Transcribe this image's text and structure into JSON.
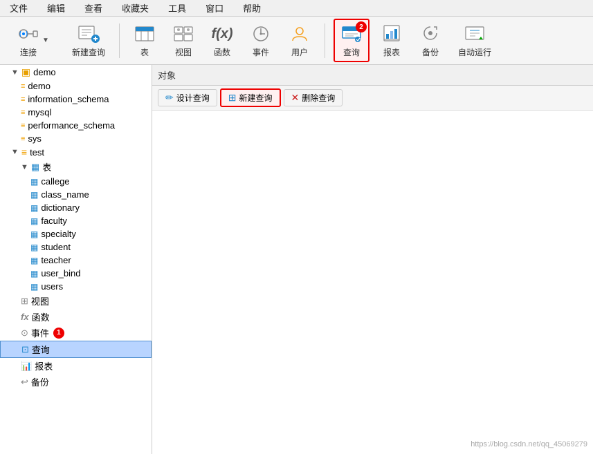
{
  "menubar": {
    "items": [
      "文件",
      "编辑",
      "查看",
      "收藏夹",
      "工具",
      "窗口",
      "帮助"
    ]
  },
  "toolbar": {
    "connect_label": "连接",
    "new_query_label": "新建查询",
    "table_label": "表",
    "view_label": "视图",
    "function_label": "函数",
    "event_label": "事件",
    "user_label": "用户",
    "query_label": "查询",
    "report_label": "报表",
    "backup_label": "备份",
    "autorun_label": "自动运行",
    "badge2": "2"
  },
  "sidebar": {
    "demo_group": "demo",
    "items": [
      {
        "label": "demo",
        "type": "db",
        "indent": 1
      },
      {
        "label": "information_schema",
        "type": "db",
        "indent": 1
      },
      {
        "label": "mysql",
        "type": "db",
        "indent": 1
      },
      {
        "label": "performance_schema",
        "type": "db",
        "indent": 1
      },
      {
        "label": "sys",
        "type": "db",
        "indent": 1
      },
      {
        "label": "test",
        "type": "db",
        "indent": 1
      },
      {
        "label": "表",
        "type": "folder",
        "indent": 2
      },
      {
        "label": "callege",
        "type": "table",
        "indent": 3
      },
      {
        "label": "class_name",
        "type": "table",
        "indent": 3
      },
      {
        "label": "dictionary",
        "type": "table",
        "indent": 3
      },
      {
        "label": "faculty",
        "type": "table",
        "indent": 3
      },
      {
        "label": "specialty",
        "type": "table",
        "indent": 3
      },
      {
        "label": "student",
        "type": "table",
        "indent": 3
      },
      {
        "label": "teacher",
        "type": "table",
        "indent": 3
      },
      {
        "label": "user_bind",
        "type": "table",
        "indent": 3
      },
      {
        "label": "users",
        "type": "table",
        "indent": 3
      },
      {
        "label": "视图",
        "type": "views",
        "indent": 2
      },
      {
        "label": "函数",
        "type": "func",
        "indent": 2
      },
      {
        "label": "事件",
        "type": "event",
        "indent": 2
      },
      {
        "label": "查询",
        "type": "query",
        "indent": 2,
        "selected": true
      },
      {
        "label": "报表",
        "type": "report",
        "indent": 2
      },
      {
        "label": "备份",
        "type": "backup",
        "indent": 2
      }
    ]
  },
  "content": {
    "header_title": "对象",
    "btn_design": "设计查询",
    "btn_new": "新建查询",
    "btn_delete": "删除查询"
  },
  "watermark": "https://blog.csdn.net/qq_45069279"
}
